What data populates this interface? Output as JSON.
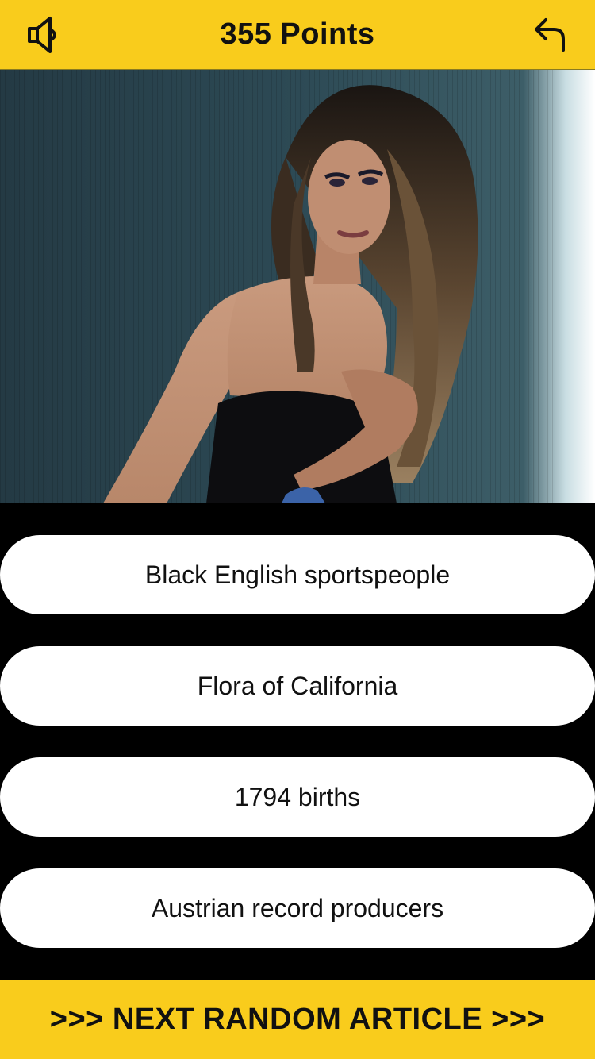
{
  "header": {
    "points_label": "355 Points",
    "sound_icon": "speaker-icon",
    "back_icon": "undo-arrow-icon"
  },
  "photo": {
    "description_alt": "Article photo"
  },
  "answers": [
    {
      "label": "Black English sportspeople"
    },
    {
      "label": "Flora of California"
    },
    {
      "label": "1794 births"
    },
    {
      "label": "Austrian record producers"
    }
  ],
  "footer": {
    "next_label": ">>> NEXT RANDOM ARTICLE >>>"
  },
  "colors": {
    "accent": "#f9cc1c",
    "background": "#000000",
    "button": "#ffffff",
    "text": "#111111"
  }
}
